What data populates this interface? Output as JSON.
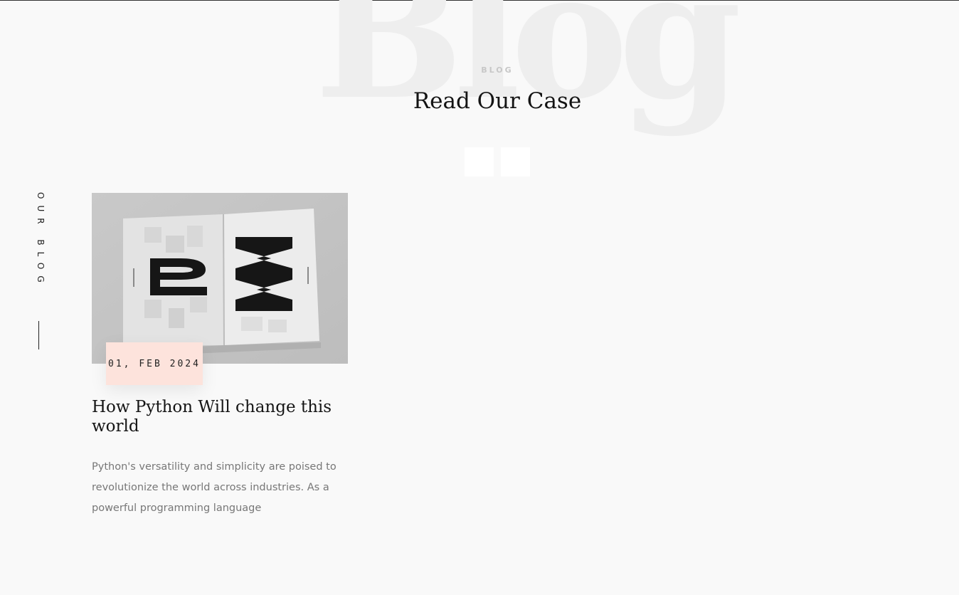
{
  "header": {
    "background_word": "Blog",
    "eyebrow": "BLOG",
    "title": "Read Our Case"
  },
  "carousel": {
    "prev_icon": "arrow-left-icon",
    "next_icon": "arrow-right-icon"
  },
  "side_label": {
    "text": "OUR BLOG"
  },
  "posts": [
    {
      "image_icon": "open-magazine-image",
      "date": "01, FEB 2024",
      "title": "How Python Will change this world",
      "excerpt": "Python's versatility and simplicity are poised to revolutionize the world across industries. As a powerful programming language"
    }
  ],
  "colors": {
    "page_background": "#f9f9f9",
    "date_badge": "#fde3dc",
    "background_word": "#eeeeee",
    "title": "#141414"
  }
}
